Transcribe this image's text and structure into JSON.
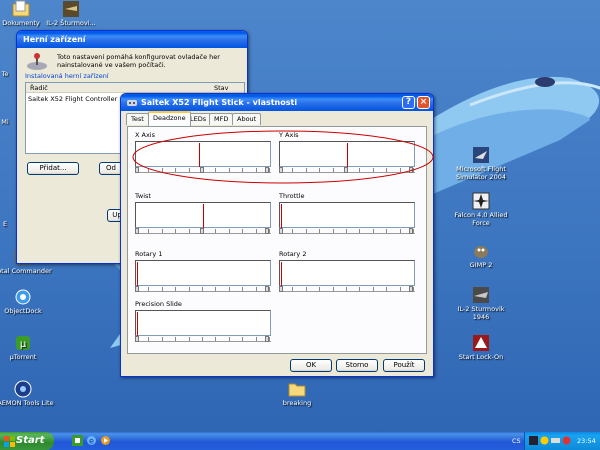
{
  "desktop": {
    "icons": [
      {
        "label": "Dokumenty",
        "icon": "documents-folder-icon"
      },
      {
        "label": "IL-2 Šturmovi...",
        "icon": "il2-game-icon"
      },
      {
        "label": "Total Commander",
        "icon": "total-commander-icon"
      },
      {
        "label": "ObjectDock",
        "icon": "objectdock-icon"
      },
      {
        "label": "µTorrent",
        "icon": "utorrent-icon"
      },
      {
        "label": "DAEMON Tools Lite",
        "icon": "daemon-tools-icon"
      },
      {
        "label": "Microsoft Flight Simulator 2004",
        "icon": "flight-sim-icon"
      },
      {
        "label": "Falcon 4.0 Allied Force",
        "icon": "falcon-icon"
      },
      {
        "label": "GIMP 2",
        "icon": "gimp-icon"
      },
      {
        "label": "IL-2 Sturmovik 1946",
        "icon": "il2-1946-icon"
      },
      {
        "label": "Start Lock-On",
        "icon": "lockon-icon"
      },
      {
        "label": "breaking",
        "icon": "folder-icon"
      }
    ],
    "partial_labels": [
      "Te",
      "Mi",
      "E"
    ]
  },
  "game_controllers": {
    "title": "Herní zařízení",
    "description": "Toto nastavení pomáhá konfigurovat ovladače her nainstalované ve vašem počítači.",
    "group_label": "Instalovaná herní zařízení",
    "col_driver": "Řadič",
    "col_status": "Stav",
    "device": "Saitek X52 Flight Controller",
    "add_button": "Přidat...",
    "remove_button_partial": "Od",
    "up_button_partial": "Up"
  },
  "properties": {
    "title": "Saitek X52 Flight Stick - vlastnosti",
    "tabs": [
      "Test",
      "Deadzone",
      "LEDs",
      "MFD",
      "About"
    ],
    "active_tab": "Deadzone",
    "axes": [
      {
        "label": "X Axis",
        "level": 0.47
      },
      {
        "label": "Y Axis",
        "level": 0.5
      },
      {
        "label": "Twist",
        "level": 0.5
      },
      {
        "label": "Throttle",
        "level": 0.0
      },
      {
        "label": "Rotary 1",
        "level": 0.0
      },
      {
        "label": "Rotary 2",
        "level": 0.0
      },
      {
        "label": "Precision Slide",
        "level": 0.0
      }
    ],
    "ok_button": "OK",
    "cancel_button": "Storno",
    "apply_button": "Použít"
  },
  "taskbar": {
    "start_label": "Start",
    "language": "CS",
    "clock": "23:54"
  },
  "colors": {
    "desktop": "#3d76c0",
    "titlebar": "#0054e3",
    "axis_marker": "#cc0000",
    "annotation_ellipse": "#cc0000",
    "start_button": "#3a963a"
  }
}
